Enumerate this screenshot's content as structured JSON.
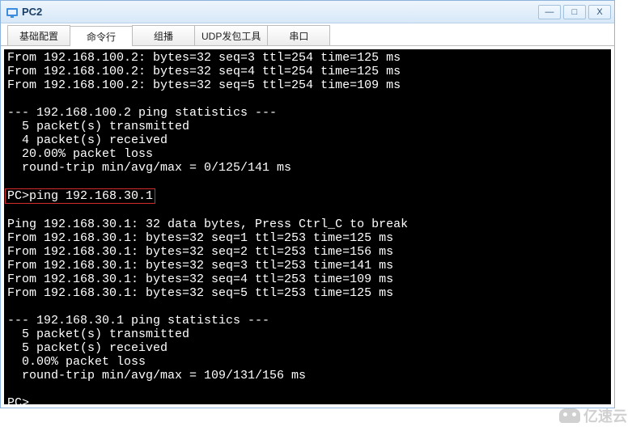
{
  "window": {
    "title": "PC2",
    "controls": {
      "min": "—",
      "max": "□",
      "close": "X"
    }
  },
  "tabs": [
    {
      "label": "基础配置"
    },
    {
      "label": "命令行"
    },
    {
      "label": "组播"
    },
    {
      "label": "UDP发包工具"
    },
    {
      "label": "串口"
    }
  ],
  "terminal": {
    "lines": [
      "From 192.168.100.2: bytes=32 seq=3 ttl=254 time=125 ms",
      "From 192.168.100.2: bytes=32 seq=4 ttl=254 time=125 ms",
      "From 192.168.100.2: bytes=32 seq=5 ttl=254 time=109 ms",
      "",
      "--- 192.168.100.2 ping statistics ---",
      "  5 packet(s) transmitted",
      "  4 packet(s) received",
      "  20.00% packet loss",
      "  round-trip min/avg/max = 0/125/141 ms",
      ""
    ],
    "command_line": "PC>ping 192.168.30.1",
    "lines2": [
      "",
      "Ping 192.168.30.1: 32 data bytes, Press Ctrl_C to break",
      "From 192.168.30.1: bytes=32 seq=1 ttl=253 time=125 ms",
      "From 192.168.30.1: bytes=32 seq=2 ttl=253 time=156 ms",
      "From 192.168.30.1: bytes=32 seq=3 ttl=253 time=141 ms",
      "From 192.168.30.1: bytes=32 seq=4 ttl=253 time=109 ms",
      "From 192.168.30.1: bytes=32 seq=5 ttl=253 time=125 ms",
      "",
      "--- 192.168.30.1 ping statistics ---",
      "  5 packet(s) transmitted",
      "  5 packet(s) received",
      "  0.00% packet loss",
      "  round-trip min/avg/max = 109/131/156 ms",
      "",
      "PC>"
    ]
  },
  "watermark": {
    "text": "亿速云"
  }
}
